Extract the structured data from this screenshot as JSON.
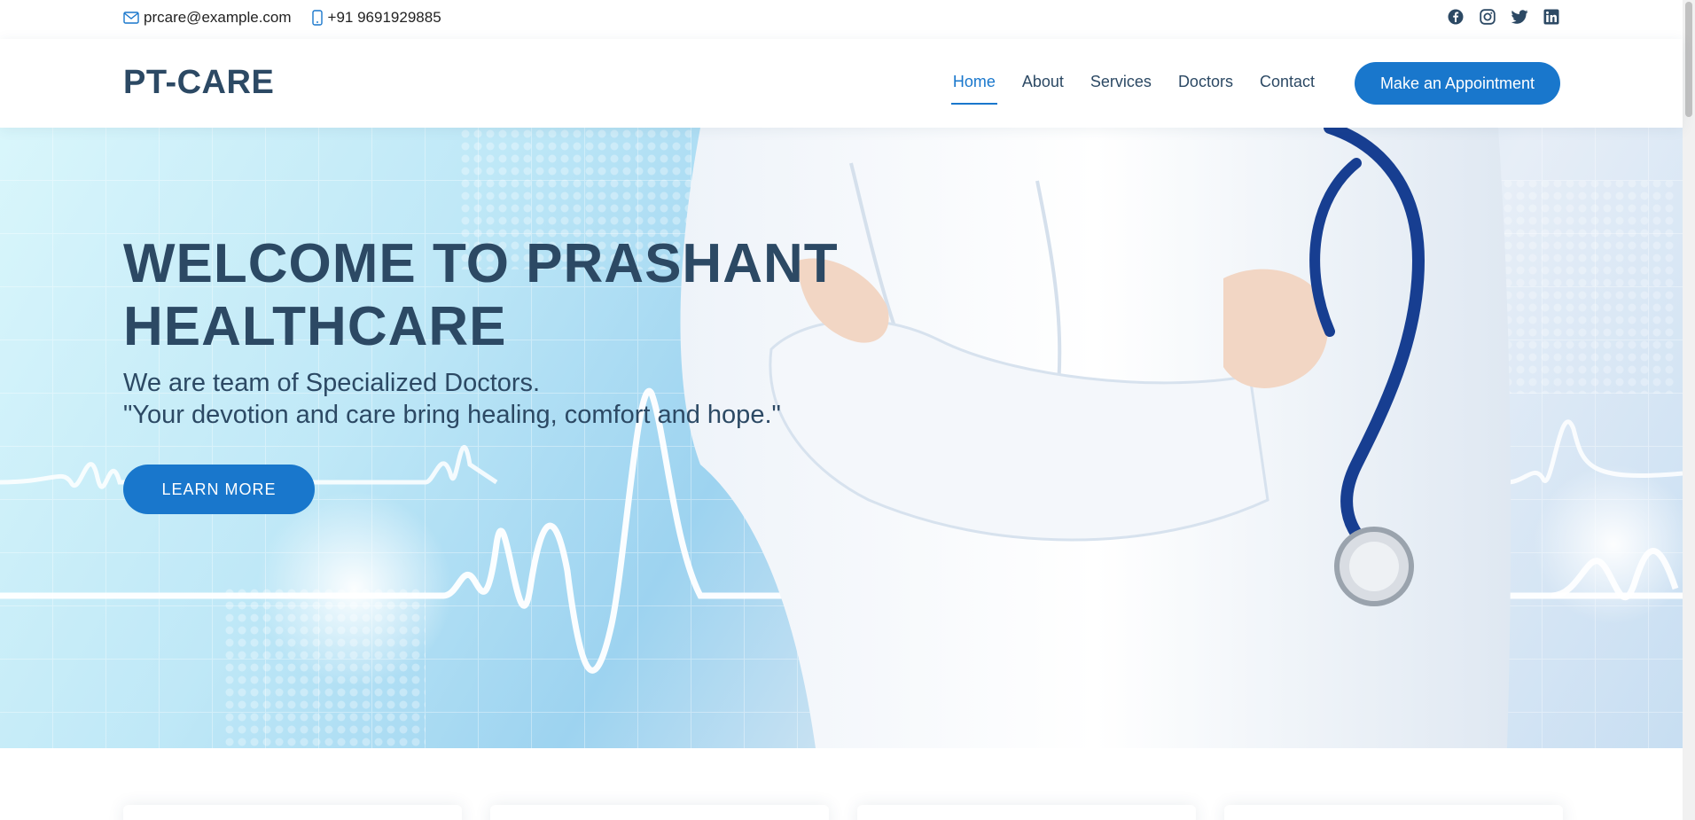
{
  "topbar": {
    "email": "prcare@example.com",
    "phone": "+91 9691929885",
    "social": [
      "facebook-icon",
      "instagram-icon",
      "twitter-icon",
      "linkedin-icon"
    ]
  },
  "header": {
    "logo": "PT-CARE",
    "nav": [
      "Home",
      "About",
      "Services",
      "Doctors",
      "Contact"
    ],
    "active_nav": "Home",
    "appointment_button": "Make an Appointment"
  },
  "hero": {
    "title_line1": "WELCOME TO PRASHANT",
    "title_line2": "HEALTHCARE",
    "subtitle_line1": "We are team of Specialized Doctors.",
    "subtitle_line2": "\"Your devotion and care bring healing, comfort and hope.\"",
    "button": "LEARN MORE"
  },
  "colors": {
    "accent": "#1977cc",
    "heading": "#2c4964"
  }
}
